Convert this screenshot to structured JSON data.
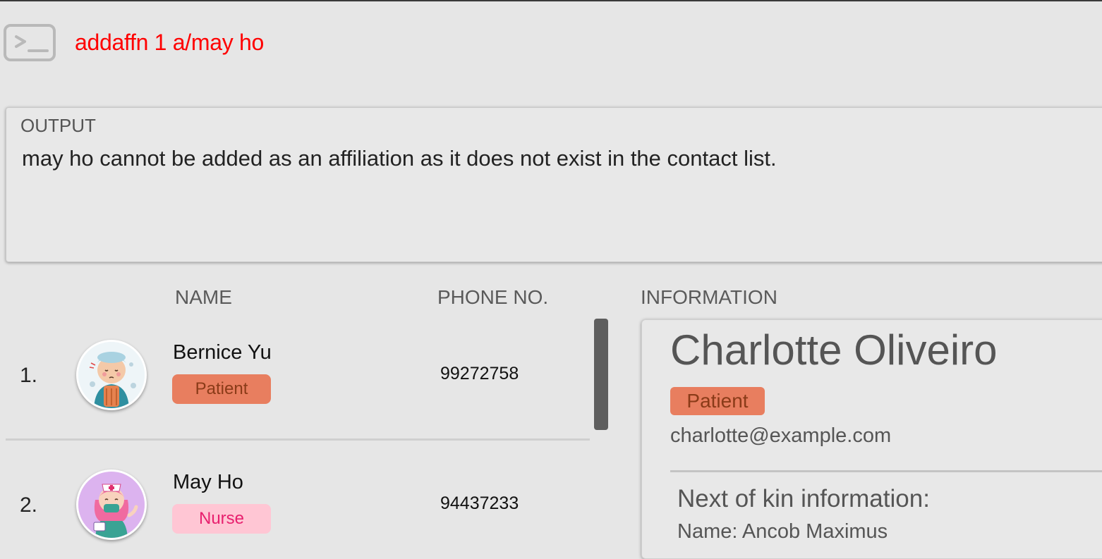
{
  "command": {
    "icon": "terminal-icon",
    "text": "addaffn 1 a/may ho",
    "text_color": "#ff0000"
  },
  "output": {
    "label": "OUTPUT",
    "message": "may ho cannot be added as an affiliation as it does not exist in the contact list."
  },
  "list": {
    "headers": {
      "name": "NAME",
      "phone": "PHONE NO.",
      "information": "INFORMATION"
    },
    "rows": [
      {
        "index": "1.",
        "name": "Bernice Yu",
        "tag": "Patient",
        "phone": "99272758",
        "avatar": "patient-avatar"
      },
      {
        "index": "2.",
        "name": "May Ho",
        "tag": "Nurse",
        "phone": "94437233",
        "avatar": "nurse-avatar"
      }
    ]
  },
  "info": {
    "name": "Charlotte Oliveiro",
    "tag": "Patient",
    "email": "charlotte@example.com",
    "nok_title": "Next of kin information:",
    "nok_name": "Name: Ancob Maximus"
  },
  "colors": {
    "patient_tag_bg": "#e87e5f",
    "patient_tag_text": "#8a3b18",
    "nurse_tag_bg": "#ffc6d4",
    "nurse_tag_text": "#e8206e"
  }
}
